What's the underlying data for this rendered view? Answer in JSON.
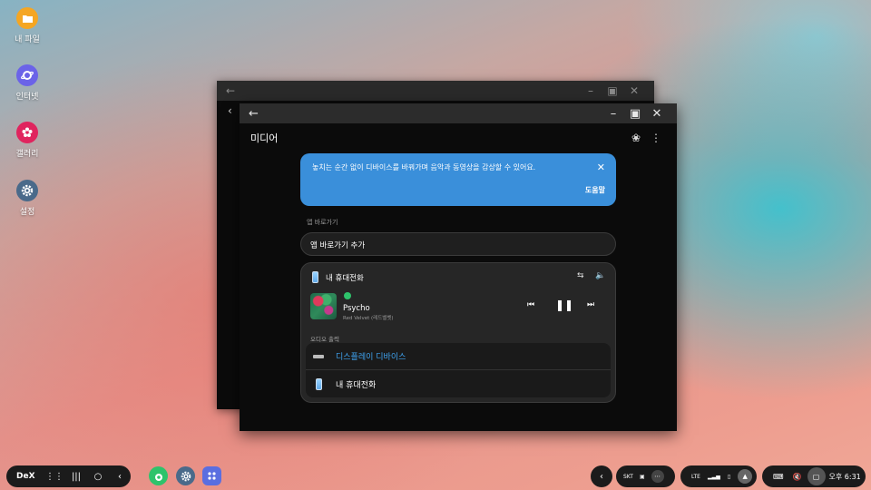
{
  "desktop_icons": [
    {
      "label": "내 파일",
      "icon": "folder-icon",
      "color": "#f5a623"
    },
    {
      "label": "인터넷",
      "icon": "internet-icon",
      "color": "#6b63e8"
    },
    {
      "label": "갤러리",
      "icon": "gallery-icon",
      "color": "#e0245e"
    },
    {
      "label": "설정",
      "icon": "settings-icon",
      "color": "#4a6a8a"
    }
  ],
  "media_window": {
    "title": "미디어",
    "banner": {
      "message": "놓치는 순간 없이 디바이스를 바꿔가며 음악과 동영상을 감상할 수 있어요.",
      "help_label": "도움말",
      "color": "#3a8fda"
    },
    "shortcuts_label": "앱 바로가기",
    "add_shortcut_label": "앱 바로가기 추가",
    "player": {
      "device_name": "내 휴대전화",
      "song_title": "Psycho",
      "artist": "Red Velvet (레드벨벳)",
      "output_label": "오디오 출력",
      "outputs": [
        {
          "label": "디스플레이 디바이스",
          "selected": true,
          "icon": "display-icon"
        },
        {
          "label": "내 휴대전화",
          "selected": false,
          "icon": "phone-icon"
        }
      ],
      "accent": "#3fa3f0"
    }
  },
  "taskbar": {
    "dex_label": "DeX",
    "carrier": "SKT",
    "network": "LTE",
    "clock": "오후 6:31"
  }
}
